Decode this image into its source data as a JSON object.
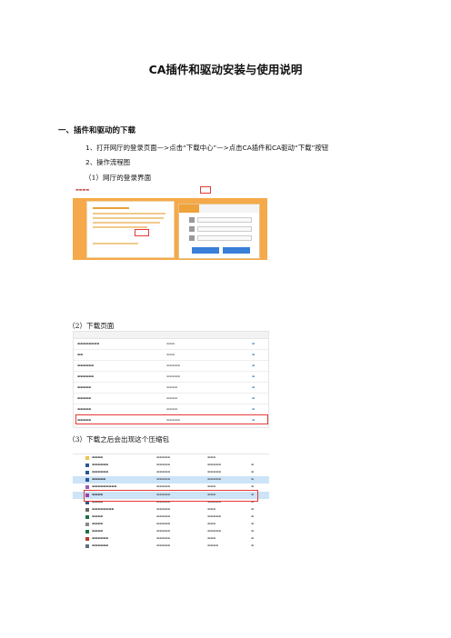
{
  "doc": {
    "title": "CA插件和驱动安装与使用说明",
    "section1": "一、插件和驱动的下载",
    "step1": "1、打开网厅的登录页面—>点击“下载中心”—>点击CA插件和CA驱动“下载”按钮",
    "step2": "2、操作流程图",
    "cap1": "（1）网厅的登录界面",
    "cap2": "（2）下载页面",
    "cap3": "（3）下载之后会出现这个压缩包"
  },
  "colors": {
    "accent_orange": "#f6a94a",
    "highlight_red": "#e53935",
    "link_blue": "#2d6fb7"
  }
}
